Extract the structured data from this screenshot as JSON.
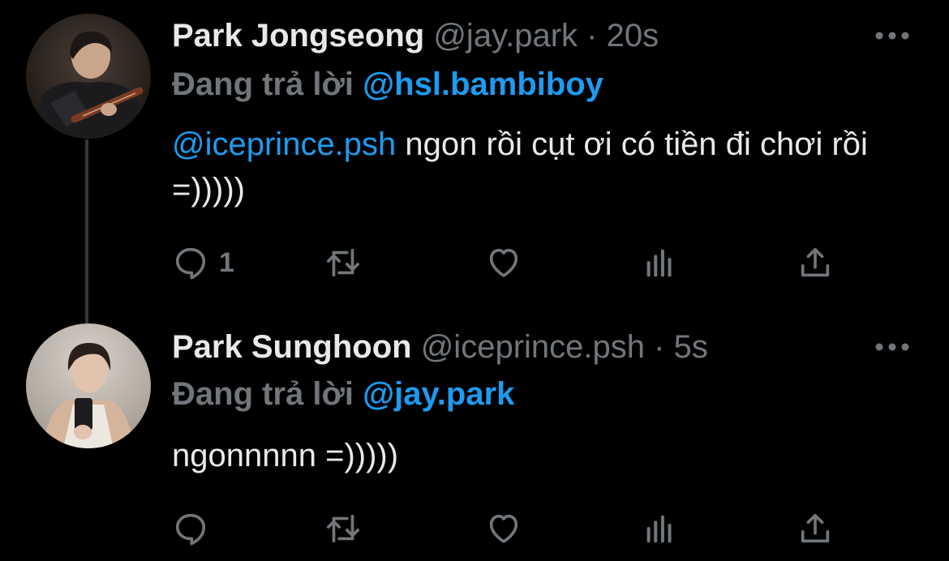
{
  "tweets": [
    {
      "display_name": "Park Jongseong",
      "handle": "@jay.park",
      "separator": "·",
      "time": "20s",
      "reply_prefix": "Đang trả lời",
      "reply_to": "@hsl.bambiboy",
      "mention": "@iceprince.psh",
      "text": " ngon rồi cụt ơi có tiền đi chơi rồi =)))))",
      "reply_count": "1"
    },
    {
      "display_name": "Park Sunghoon",
      "handle": "@iceprince.psh",
      "separator": "·",
      "time": "5s",
      "reply_prefix": "Đang trả lời",
      "reply_to": "@jay.park",
      "text": "ngonnnnn =)))))",
      "reply_count": ""
    }
  ],
  "icons": {
    "reply": "reply-icon",
    "retweet": "retweet-icon",
    "like": "heart-icon",
    "views": "analytics-icon",
    "share": "share-icon",
    "more": "more-icon"
  },
  "colors": {
    "background": "#000000",
    "text": "#e7e9ea",
    "muted": "#71767b",
    "accent": "#1d9bf0",
    "thread_line": "#333639"
  }
}
